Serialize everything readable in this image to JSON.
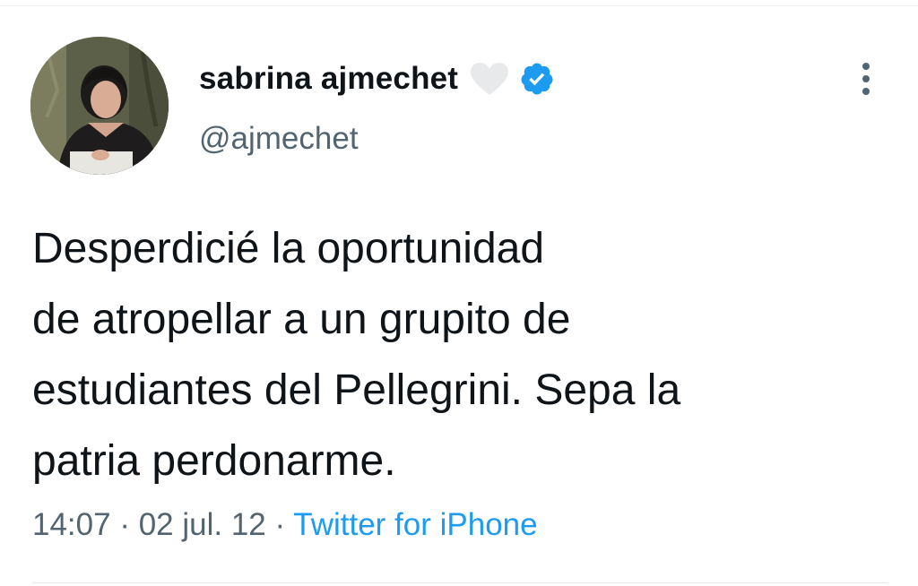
{
  "tweet": {
    "author": {
      "display_name": "sabrina ajmechet",
      "handle": "@ajmechet",
      "verified": true,
      "badge_icons": [
        "heart-icon",
        "verified-icon"
      ]
    },
    "text_lines": [
      "Desperdicié la oportunidad",
      "de atropellar a un grupito de",
      "estudiantes del Pellegrini. Sepa la",
      "patria perdonarme."
    ],
    "time": "14:07",
    "date": "02 jul. 12",
    "separator": " · ",
    "source": "Twitter for iPhone",
    "more_icon": "more-vertical-icon"
  },
  "colors": {
    "text_primary": "#0f1419",
    "text_secondary": "#536471",
    "link": "#1d9bf0",
    "verified_badge": "#1d9bf0"
  }
}
